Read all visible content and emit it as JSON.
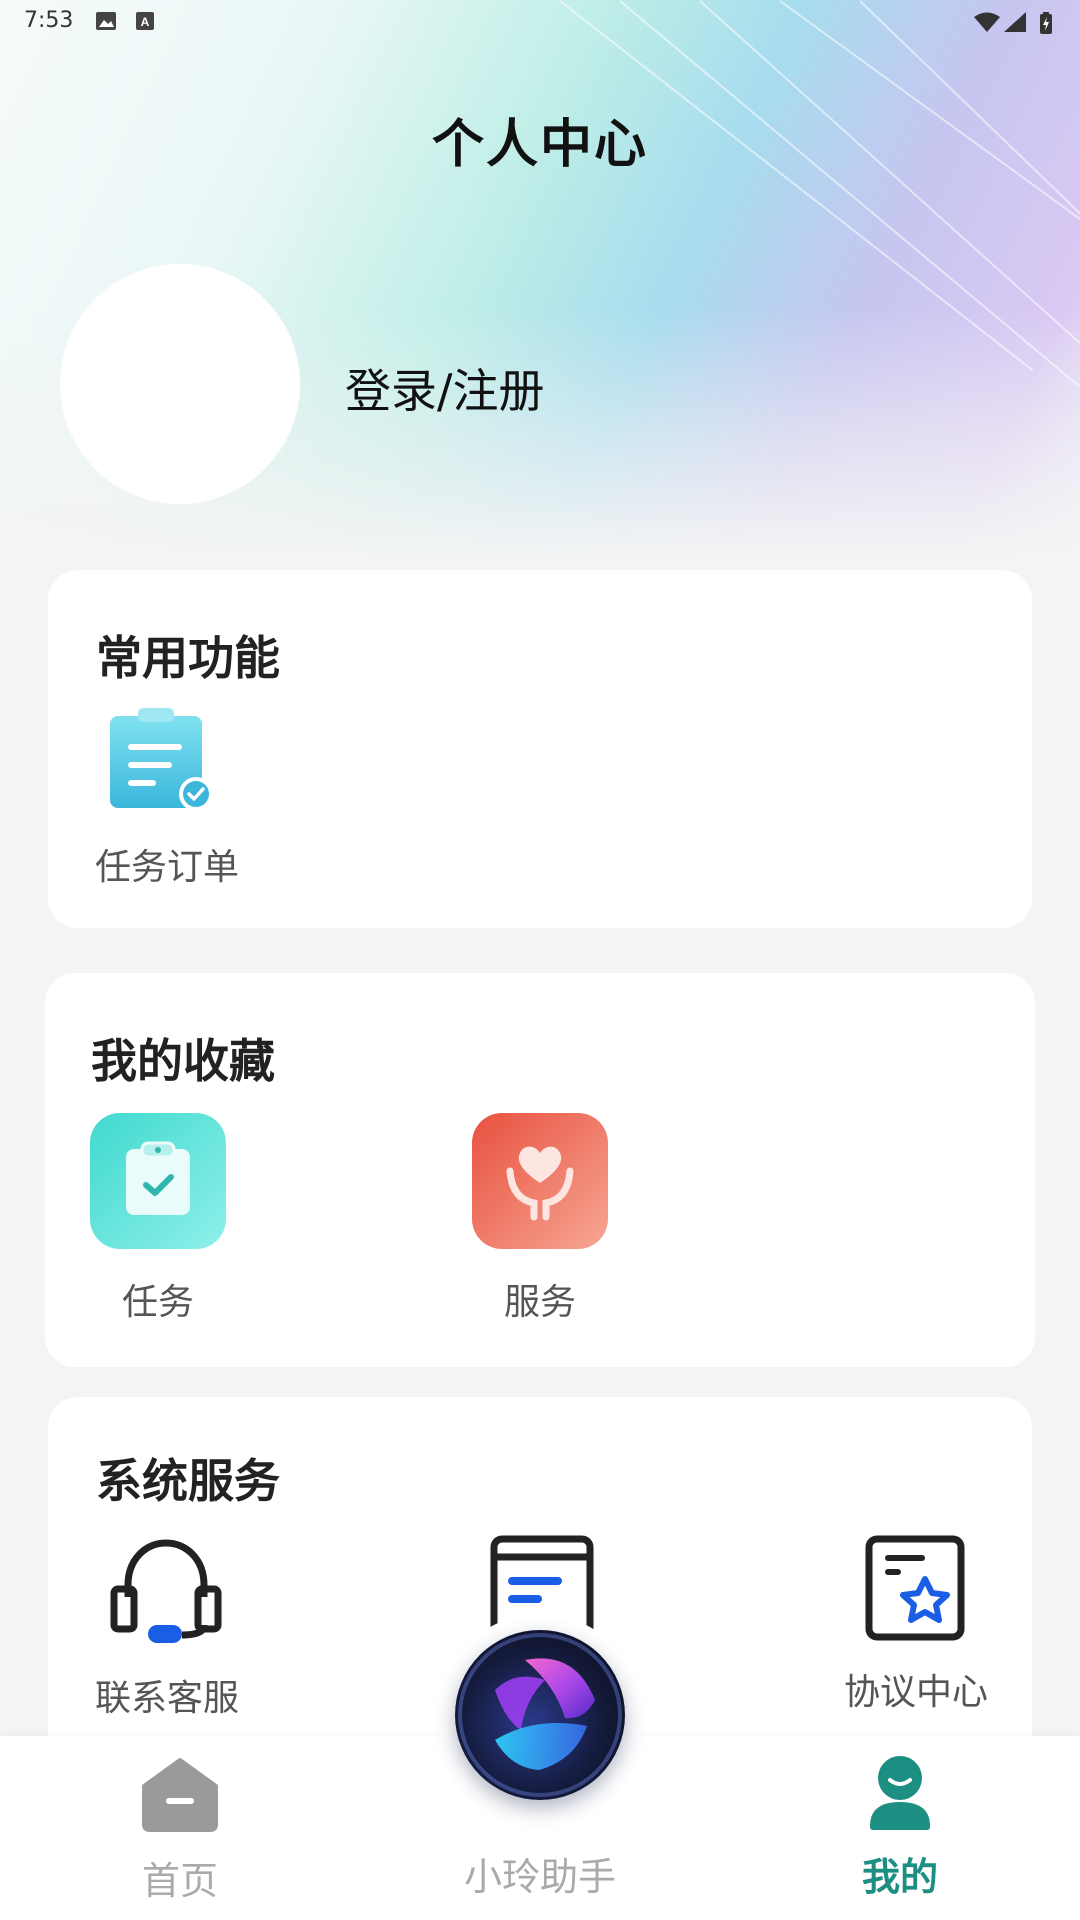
{
  "status_bar": {
    "time": "7:53"
  },
  "header": {
    "title": "个人中心"
  },
  "profile": {
    "login_label": "登录/注册"
  },
  "common_functions": {
    "title": "常用功能",
    "items": [
      {
        "label": "任务订单",
        "icon": "task-order-icon"
      }
    ]
  },
  "favorites": {
    "title": "我的收藏",
    "items": [
      {
        "label": "任务",
        "icon": "task-clipboard-icon"
      },
      {
        "label": "服务",
        "icon": "service-heart-icon"
      }
    ]
  },
  "system_services": {
    "title": "系统服务",
    "items": [
      {
        "label": "联系客服",
        "icon": "headset-icon"
      },
      {
        "label": "",
        "icon": "document-icon"
      },
      {
        "label": "协议中心",
        "icon": "agreement-star-icon"
      }
    ]
  },
  "tabbar": {
    "items": [
      {
        "label": "首页",
        "icon": "home-icon",
        "active": false
      },
      {
        "label": "小玲助手",
        "icon": "assistant-orb-icon",
        "active": false
      },
      {
        "label": "我的",
        "icon": "profile-icon",
        "active": true
      }
    ],
    "active_color": "#1d8f82",
    "inactive_color": "#aaaaaa"
  }
}
